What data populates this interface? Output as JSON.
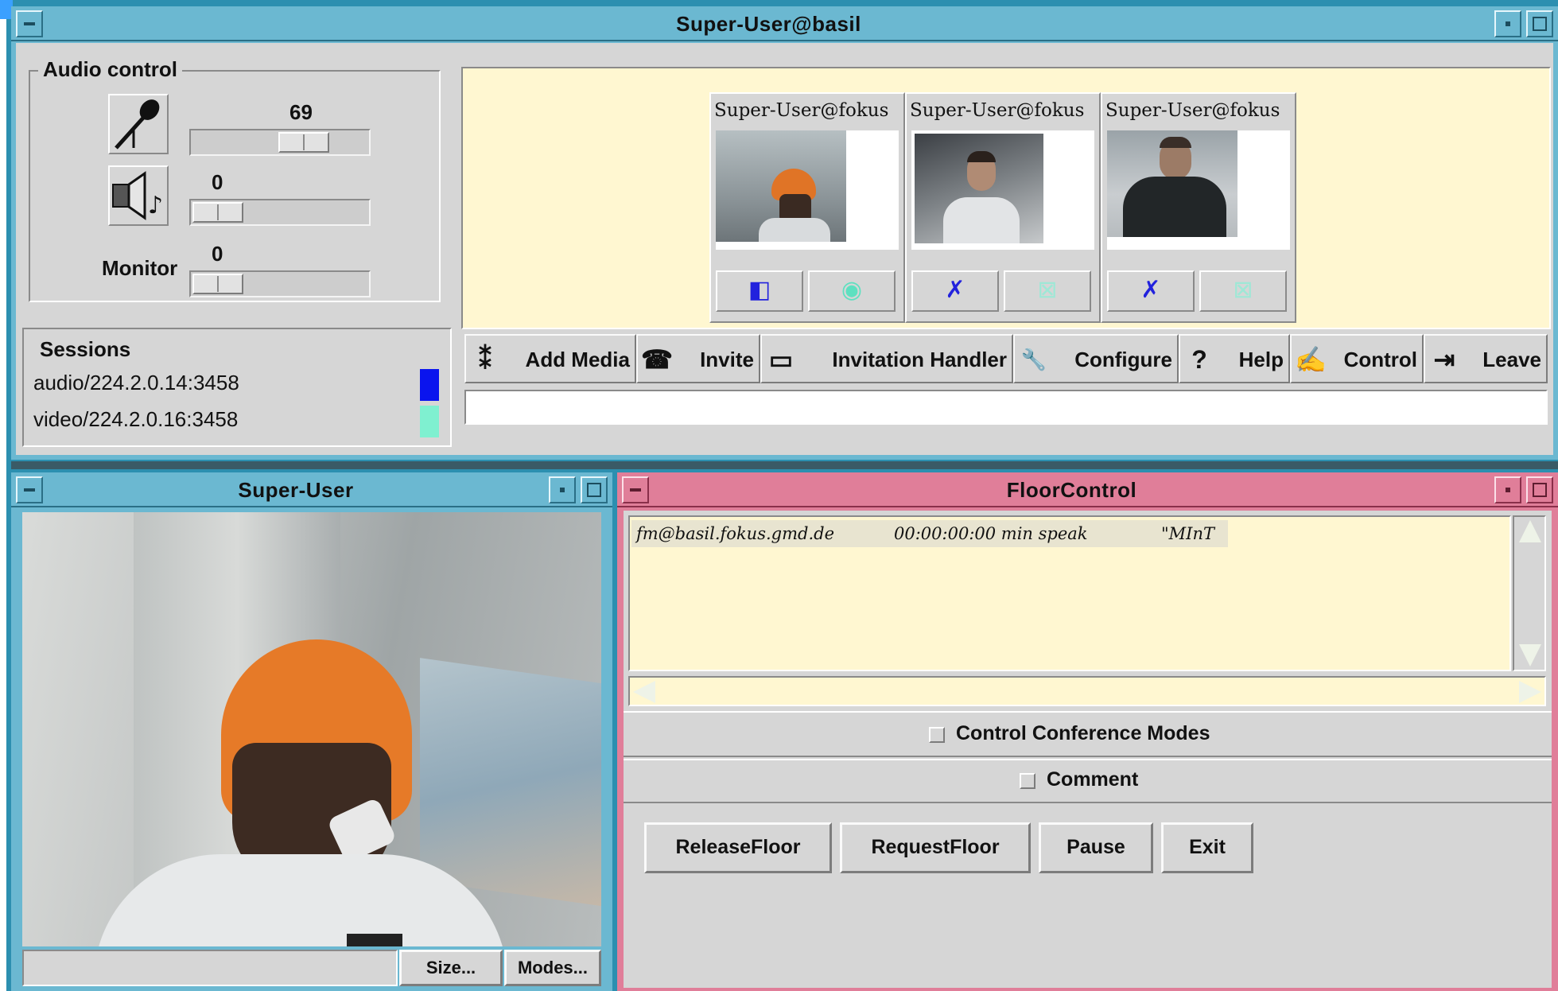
{
  "main_window": {
    "title": "Super-User@basil"
  },
  "audio_control": {
    "group_label": "Audio control",
    "mic_value": "69",
    "mic_level": 0.69,
    "speaker_value": "0",
    "speaker_level": 0,
    "monitor_label": "Monitor",
    "monitor_value": "0",
    "monitor_level": 0,
    "mic_icon": "microphone-icon",
    "speaker_icon": "speaker-icon"
  },
  "sessions": {
    "group_label": "Sessions",
    "items": [
      {
        "address": "audio/224.2.0.14:3458",
        "color": "#0a14ee"
      },
      {
        "address": "video/224.2.0.16:3458",
        "color": "#7ff0d0"
      }
    ]
  },
  "participants": [
    {
      "name": "Super-User@fokus",
      "audio_icon": "speaker-icon",
      "video_icon": "eye-icon",
      "turban": true
    },
    {
      "name": "Super-User@fokus",
      "audio_icon": "mute-icon",
      "video_icon": "eye-crossed-icon",
      "turban": false
    },
    {
      "name": "Super-User@fokus",
      "audio_icon": "mute-icon",
      "video_icon": "eye-crossed-icon",
      "turban": false
    }
  ],
  "toolbar": [
    {
      "label": "Add Media",
      "icon": "add-media-icon",
      "glyph": "⁑"
    },
    {
      "label": "Invite",
      "icon": "telephone-icon",
      "glyph": "☎"
    },
    {
      "label": "Invitation Handler",
      "icon": "folder-icon",
      "glyph": "▭"
    },
    {
      "label": "Configure",
      "icon": "wrench-icon",
      "glyph": "🔧"
    },
    {
      "label": "Help",
      "icon": "question-icon",
      "glyph": "?"
    },
    {
      "label": "Control",
      "icon": "hand-icon",
      "glyph": "✍"
    },
    {
      "label": "Leave",
      "icon": "exit-icon",
      "glyph": "⇥"
    }
  ],
  "video_window": {
    "title": "Super-User",
    "status_text": "",
    "size_button": "Size...",
    "modes_button": "Modes..."
  },
  "floor_control": {
    "title": "FloorControl",
    "list": [
      {
        "user": "fm@basil.fokus.gmd.de",
        "time": "00:00:00:00 min speak",
        "note": "\"MInT"
      }
    ],
    "control_modes_label": "Control Conference Modes",
    "comment_label": "Comment",
    "buttons": [
      "ReleaseFloor",
      "RequestFloor",
      "Pause",
      "Exit"
    ]
  },
  "colors": {
    "title_blue": "#6bb8d1",
    "title_pink": "#e07e99",
    "panel_gray": "#d6d6d6",
    "video_area": "#fff7d1"
  }
}
